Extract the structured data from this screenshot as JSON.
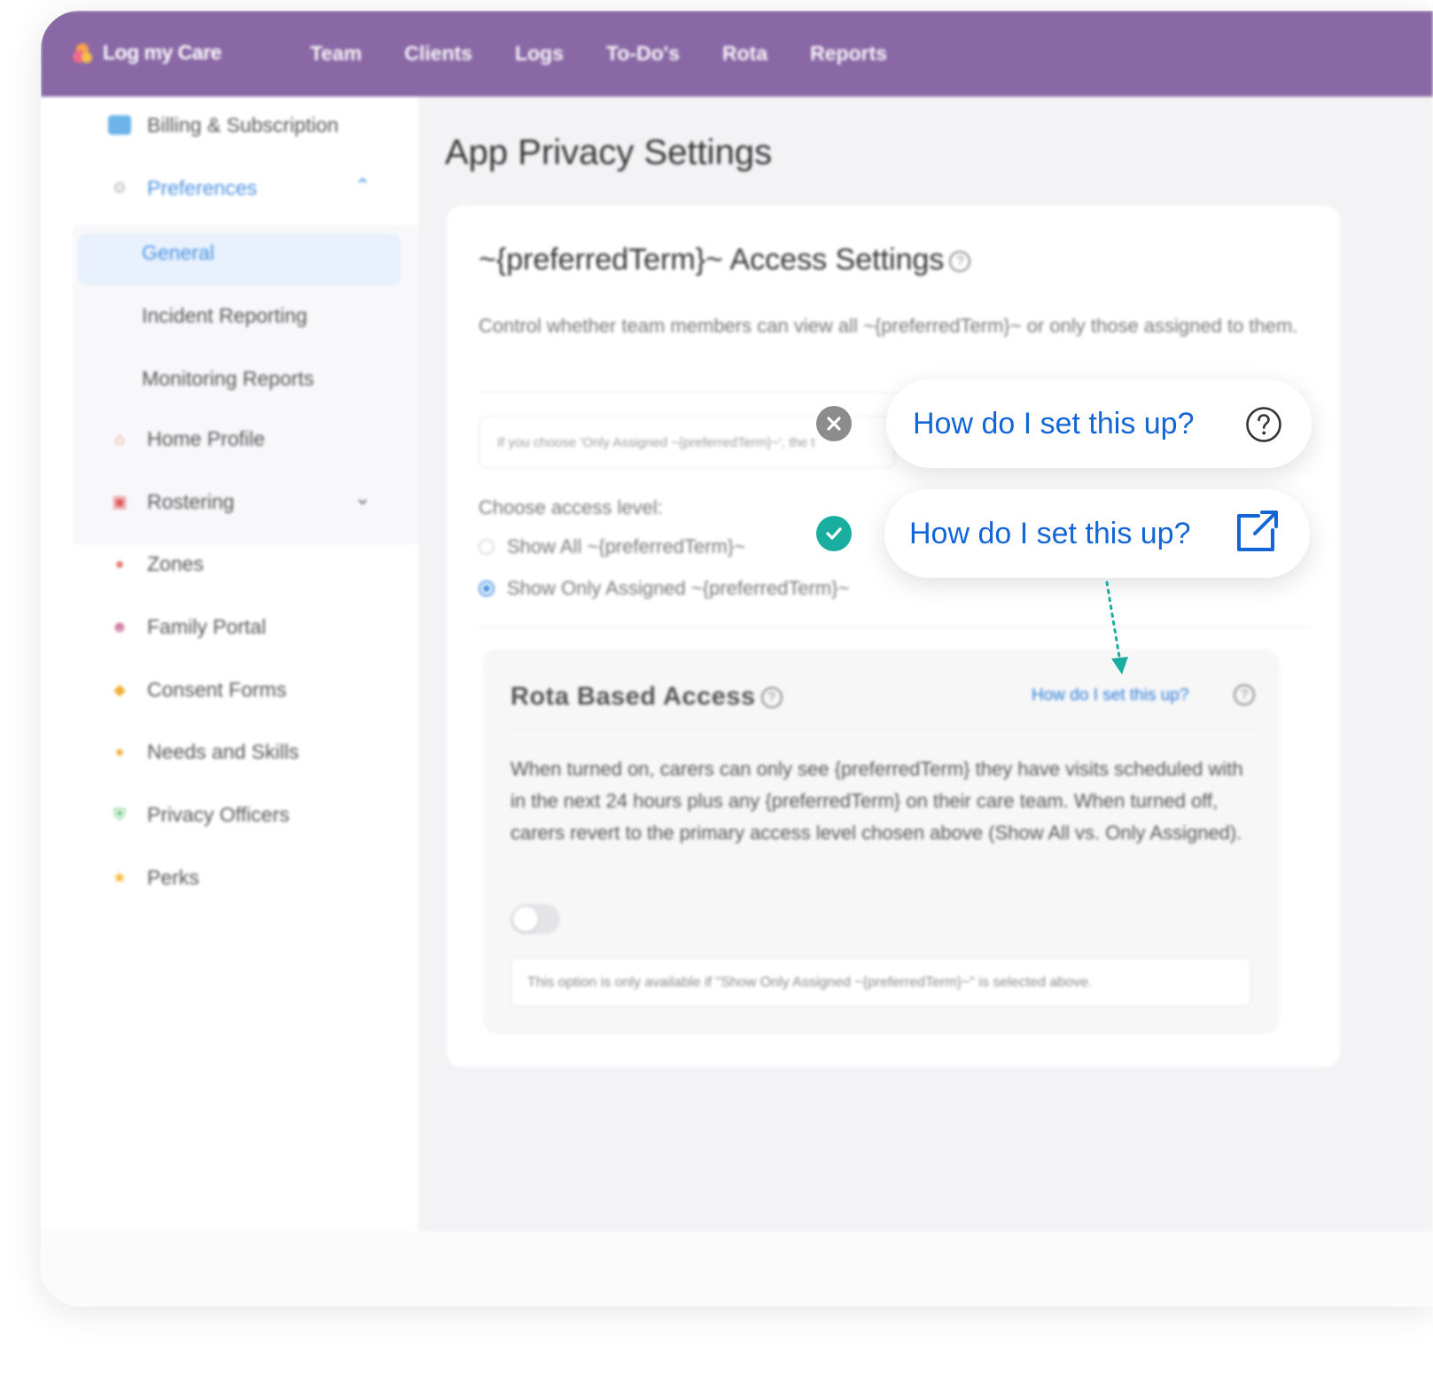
{
  "app": {
    "name": "Log my Care",
    "nav": [
      "Team",
      "Clients",
      "Logs",
      "To-Do's",
      "Rota",
      "Reports"
    ]
  },
  "sidebar": {
    "items": [
      {
        "label": "Billing & Subscription",
        "icon": "card-icon"
      },
      {
        "label": "Preferences",
        "icon": "gear-icon",
        "expanded": true
      },
      {
        "label": "Home Profile",
        "icon": "house-icon"
      },
      {
        "label": "Rostering",
        "icon": "calendar-icon"
      },
      {
        "label": "Zones",
        "icon": "pin-icon"
      },
      {
        "label": "Family Portal",
        "icon": "family-icon"
      },
      {
        "label": "Consent Forms",
        "icon": "handshake-icon"
      },
      {
        "label": "Needs and Skills",
        "icon": "person-icon"
      },
      {
        "label": "Privacy Officers",
        "icon": "shield-icon"
      },
      {
        "label": "Perks",
        "icon": "star-icon"
      }
    ],
    "preferences_sub": [
      "General",
      "Incident Reporting",
      "Monitoring Reports"
    ],
    "active_sub": "General"
  },
  "main": {
    "page_title": "App Privacy Settings",
    "card_title": "~{preferredTerm}~ Access Settings",
    "card_desc": "Control whether team members can view all ~{preferredTerm}~ or only those assigned to them.",
    "info_text": "If you choose 'Only Assigned ~{preferredTerm}~', the t",
    "choose_label": "Choose access level:",
    "options": [
      "Show All ~{preferredTerm}~",
      "Show Only Assigned ~{preferredTerm}~"
    ],
    "selected_option": 1,
    "rota": {
      "title": "Rota Based Access",
      "link": "How do I set this up?",
      "text": "When turned on, carers can only see {preferredTerm} they have visits scheduled with in the next 24 hours plus any {preferredTerm} on their care team. When turned off, carers revert to the primary access level chosen above (Show All vs. Only Assigned).",
      "toggle_on": false,
      "note": "This option is only available if \"Show Only Assigned ~{preferredTerm}~\" is selected above."
    }
  },
  "callouts": {
    "bad": {
      "label": "How do I set this up?",
      "icon": "question-icon"
    },
    "good": {
      "label": "How do I set this up?",
      "icon": "external-link-icon"
    },
    "colors": {
      "bad_mark": "#8c8c8c",
      "good_mark": "#1aaea0",
      "link": "#1366d6",
      "brand": "#8a68a6"
    }
  }
}
